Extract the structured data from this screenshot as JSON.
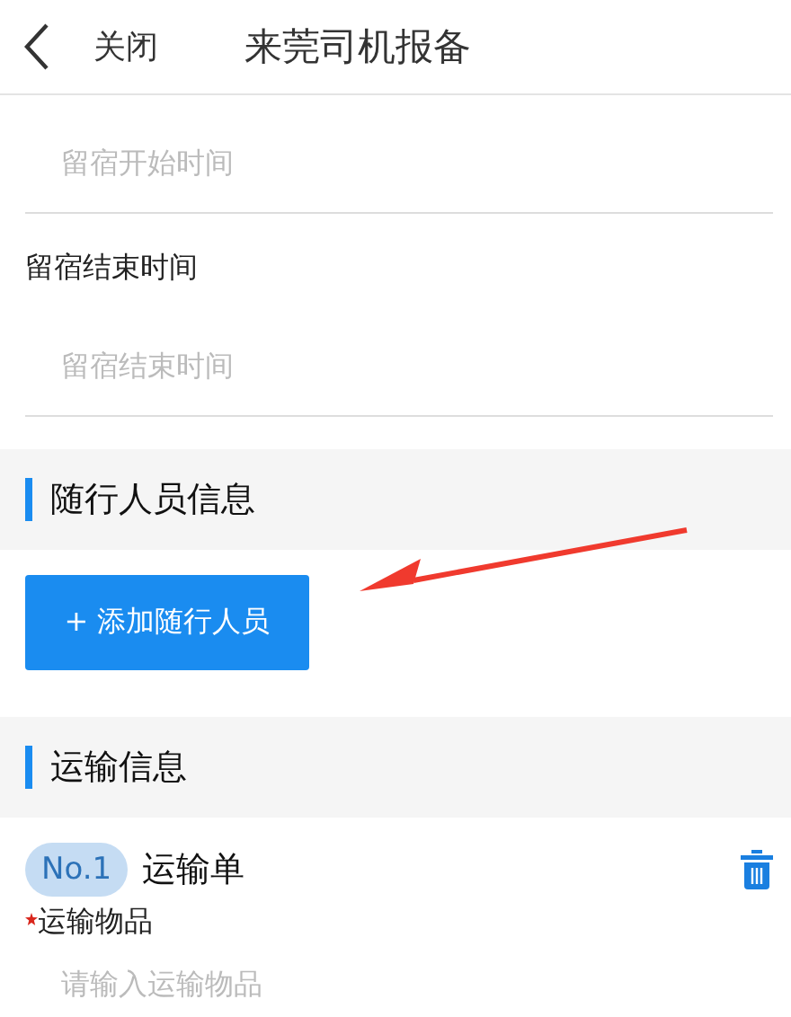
{
  "header": {
    "close": "关闭",
    "title": "来莞司机报备"
  },
  "stay_fields": [
    {
      "placeholder": "留宿开始时间"
    },
    {
      "label": "留宿结束时间",
      "placeholder": "留宿结束时间"
    }
  ],
  "companions": {
    "heading": "随行人员信息",
    "add_button": "+ 添加随行人员"
  },
  "transport": {
    "heading": "运输信息",
    "orders": [
      {
        "number": "No.1",
        "title": "运输单",
        "fields": [
          {
            "label": "运输物品",
            "required": true,
            "placeholder": "请输入运输物品"
          }
        ]
      }
    ]
  }
}
